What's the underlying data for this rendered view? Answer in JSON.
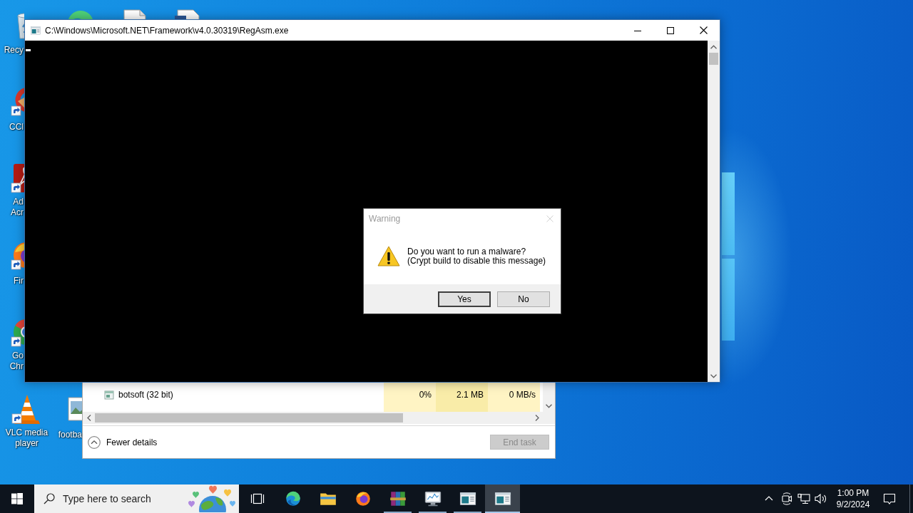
{
  "desktop": {
    "icons": [
      {
        "kind": "recycle-bin",
        "shortcut": false,
        "lines": [
          "Recy"
        ]
      },
      {
        "kind": "cleaner",
        "shortcut": true,
        "lines": [
          "CCl"
        ]
      },
      {
        "kind": "pdf",
        "shortcut": true,
        "lines": [
          "Ad",
          "Acr"
        ]
      },
      {
        "kind": "firefox",
        "shortcut": true,
        "lines": [
          "Fir"
        ]
      },
      {
        "kind": "chrome",
        "shortcut": true,
        "lines": [
          "Go",
          "Chr"
        ]
      },
      {
        "kind": "vlc",
        "shortcut": true,
        "lines": [
          "VLC media",
          "player"
        ]
      },
      {
        "kind": "edge"
      },
      {
        "kind": "document"
      },
      {
        "kind": "word"
      },
      {
        "kind": "image",
        "shortcut": false,
        "lines": [
          "footba"
        ]
      }
    ]
  },
  "console_window": {
    "title": "C:\\Windows\\Microsoft.NET\\Framework\\v4.0.30319\\RegAsm.exe"
  },
  "dialog": {
    "title": "Warning",
    "lines": [
      "Do you want to run a malware?",
      "(Crypt build to disable this message)"
    ],
    "buttons": [
      {
        "label": "Yes",
        "default": true
      },
      {
        "label": "No",
        "default": false
      }
    ]
  },
  "task_manager": {
    "rows": [
      {
        "name": "botsoft (32 bit)",
        "cells": [
          "0%",
          "2.1 MB",
          "0 MB/s"
        ]
      }
    ],
    "details_toggle": "Fewer details",
    "end_task": {
      "label": "End task",
      "disabled": true
    }
  },
  "taskbar": {
    "search": {
      "placeholder": "Type here to search"
    },
    "apps": [
      {
        "kind": "edge",
        "running": false,
        "selected": false
      },
      {
        "kind": "explorer",
        "running": false,
        "selected": false
      },
      {
        "kind": "firefox",
        "running": false,
        "selected": false
      },
      {
        "kind": "archive",
        "running": true,
        "selected": false
      },
      {
        "kind": "monitor",
        "running": true,
        "selected": false
      },
      {
        "kind": "console",
        "running": true,
        "selected": false
      },
      {
        "kind": "console",
        "running": true,
        "selected": true
      }
    ],
    "clock": {
      "time": "1:00 PM",
      "date": "9/2/2024"
    }
  }
}
